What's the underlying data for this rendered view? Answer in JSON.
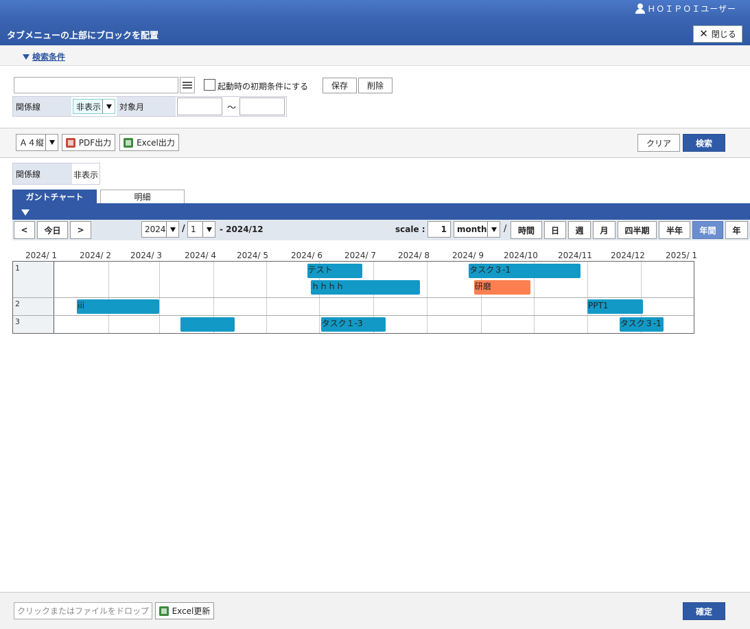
{
  "header": {
    "user": "ＨＯＩＰＯＩユーザー",
    "title": "タブメニューの上部にブロックを配置",
    "close_label": "閉じる"
  },
  "search": {
    "toggle_label": "検索条件",
    "text_value": "",
    "default_condition_label": "起動時の初期条件にする",
    "save_label": "保存",
    "delete_label": "削除",
    "relation_label": "関係線",
    "relation_value": "非表示",
    "target_month_label": "対象月",
    "month_from": "",
    "month_to": "",
    "tilde": "～"
  },
  "toolbar": {
    "paper_select": "Ａ４縦",
    "pdf_label": "PDF出力",
    "excel_label": "Excel出力",
    "clear_label": "クリア",
    "search_label": "検索"
  },
  "info": {
    "relation_label": "関係線",
    "relation_value": "非表示"
  },
  "tabs": [
    {
      "label": "ガントチャート",
      "active": true
    },
    {
      "label": "明細",
      "active": false
    }
  ],
  "nav": {
    "prev": "<",
    "today": "今日",
    "next": ">",
    "year": "2024",
    "slash": "/",
    "month": "1",
    "range_end": "- 2024/12",
    "scale_label": "scale :",
    "scale_value": "1",
    "unit": "month",
    "slash2": "/",
    "views": [
      "時間",
      "日",
      "週",
      "月",
      "四半期",
      "半年",
      "年間",
      "年"
    ],
    "selected_view": "年間"
  },
  "gantt": {
    "months": [
      "2024/ 1",
      "2024/ 2",
      "2024/ 3",
      "2024/ 4",
      "2024/ 5",
      "2024/ 6",
      "2024/ 7",
      "2024/ 8",
      "2024/ 9",
      "2024/10",
      "2024/11",
      "2024/12",
      "2025/ 1"
    ],
    "rows": [
      "1",
      "2",
      "3"
    ],
    "tasks": [
      {
        "label": "テスト",
        "row": 1,
        "lane": 0,
        "start": "2024-05-25",
        "end": "2024-06-25",
        "color": "#1399c6"
      },
      {
        "label": "ｈｈｈｈ",
        "row": 1,
        "lane": 1,
        "start": "2024-05-27",
        "end": "2024-07-28",
        "color": "#1399c6"
      },
      {
        "label": "タスク３-1",
        "row": 1,
        "lane": 0,
        "start": "2024-08-25",
        "end": "2024-10-28",
        "color": "#1399c6"
      },
      {
        "label": "研磨",
        "row": 1,
        "lane": 1,
        "start": "2024-08-28",
        "end": "2024-09-29",
        "color": "#fe7f50"
      },
      {
        "label": "iii",
        "row": 2,
        "lane": 0,
        "start": "2024-01-14",
        "end": "2024-03-01",
        "color": "#1399c6"
      },
      {
        "label": "PPT1",
        "row": 2,
        "lane": 0,
        "start": "2024-11-01",
        "end": "2024-12-02",
        "color": "#1399c6"
      },
      {
        "label": "",
        "row": 3,
        "lane": 0,
        "start": "2024-03-13",
        "end": "2024-04-13",
        "color": "#1399c6"
      },
      {
        "label": "タスク１-3",
        "row": 3,
        "lane": 0,
        "start": "2024-06-02",
        "end": "2024-07-08",
        "color": "#1399c6"
      },
      {
        "label": "タスク３-1",
        "row": 3,
        "lane": 0,
        "start": "2024-11-19",
        "end": "2024-12-14",
        "color": "#1399c6"
      }
    ]
  },
  "footer": {
    "drop_label": "クリックまたはファイルをドロップ",
    "excel_update_label": "Excel更新",
    "confirm_label": "確定"
  }
}
